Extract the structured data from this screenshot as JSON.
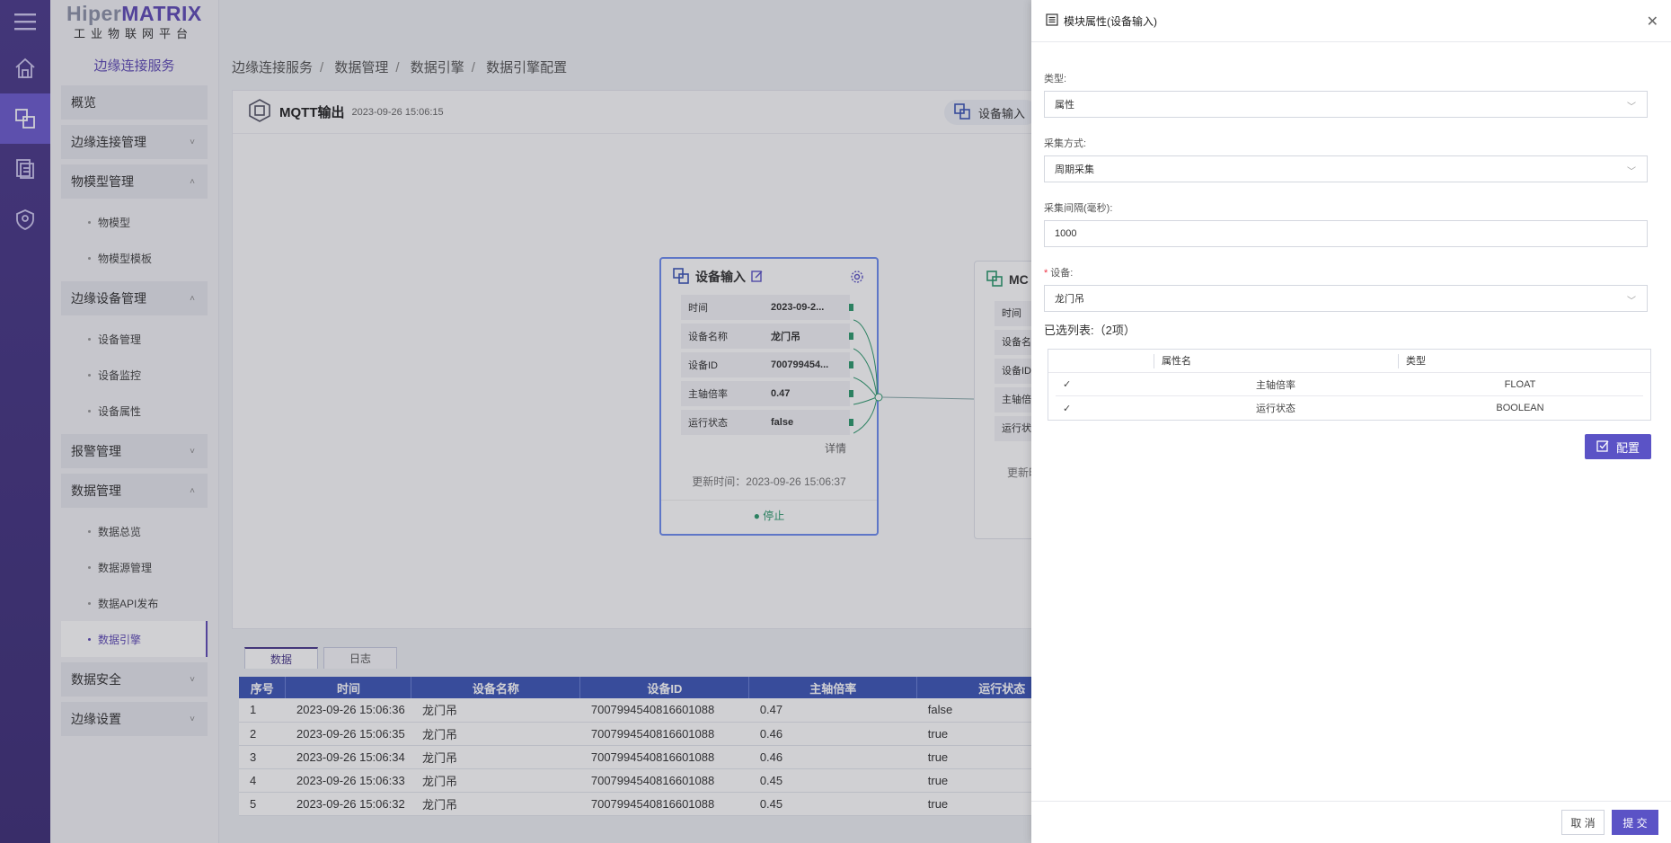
{
  "brand": {
    "name_prefix": "Hiper",
    "name_suffix": "MATRIX",
    "subtitle": "工业物联网平台"
  },
  "sidebar": {
    "service_title": "边缘连接服务",
    "items": [
      {
        "label": "概览",
        "type": "item"
      },
      {
        "label": "边缘连接管理",
        "type": "group",
        "chev": "˅"
      },
      {
        "label": "物模型管理",
        "type": "group",
        "chev": "˄"
      },
      {
        "label": "物模型",
        "type": "sub"
      },
      {
        "label": "物模型模板",
        "type": "sub"
      },
      {
        "label": "边缘设备管理",
        "type": "group",
        "chev": "˄"
      },
      {
        "label": "设备管理",
        "type": "sub"
      },
      {
        "label": "设备监控",
        "type": "sub"
      },
      {
        "label": "设备属性",
        "type": "sub"
      },
      {
        "label": "报警管理",
        "type": "group",
        "chev": "˅"
      },
      {
        "label": "数据管理",
        "type": "group",
        "chev": "˄"
      },
      {
        "label": "数据总览",
        "type": "sub"
      },
      {
        "label": "数据源管理",
        "type": "sub"
      },
      {
        "label": "数据API发布",
        "type": "sub"
      },
      {
        "label": "数据引擎",
        "type": "sub",
        "active": true
      },
      {
        "label": "数据安全",
        "type": "group",
        "chev": "˅"
      },
      {
        "label": "边缘设置",
        "type": "group",
        "chev": "˅"
      }
    ]
  },
  "breadcrumb": [
    "边缘连接服务",
    "数据管理",
    "数据引擎",
    "数据引擎配置"
  ],
  "canvas": {
    "title": "MQTT输出",
    "timestamp": "2023-09-26 15:06:15",
    "chip_label": "设备输入",
    "node": {
      "title": "设备输入",
      "rows": [
        {
          "k": "时间",
          "v": "2023-09-2..."
        },
        {
          "k": "设备名称",
          "v": "龙门吊"
        },
        {
          "k": "设备ID",
          "v": "700799454..."
        },
        {
          "k": "主轴倍率",
          "v": "0.47"
        },
        {
          "k": "运行状态",
          "v": "false"
        }
      ],
      "detail": "详情",
      "updated": "更新时间：2023-09-26 15:06:37",
      "status": "停止"
    },
    "node2": {
      "title": "MC",
      "rows": [
        "时间",
        "设备名",
        "设备ID",
        "主轴倍",
        "运行状"
      ],
      "updated": "更新时"
    }
  },
  "tabs": [
    "数据",
    "日志"
  ],
  "table": {
    "headers": [
      "序号",
      "时间",
      "设备名称",
      "设备ID",
      "主轴倍率",
      "运行状态"
    ],
    "rows": [
      [
        "1",
        "2023-09-26 15:06:36",
        "龙门吊",
        "7007994540816601088",
        "0.47",
        "false"
      ],
      [
        "2",
        "2023-09-26 15:06:35",
        "龙门吊",
        "7007994540816601088",
        "0.46",
        "true"
      ],
      [
        "3",
        "2023-09-26 15:06:34",
        "龙门吊",
        "7007994540816601088",
        "0.46",
        "true"
      ],
      [
        "4",
        "2023-09-26 15:06:33",
        "龙门吊",
        "7007994540816601088",
        "0.45",
        "true"
      ],
      [
        "5",
        "2023-09-26 15:06:32",
        "龙门吊",
        "7007994540816601088",
        "0.45",
        "true"
      ]
    ]
  },
  "drawer": {
    "title": "模块属性(设备输入)",
    "type_label": "类型:",
    "type_value": "属性",
    "method_label": "采集方式:",
    "method_value": "周期采集",
    "interval_label": "采集间隔(毫秒):",
    "interval_value": "1000",
    "device_label": "设备:",
    "device_value": "龙门吊",
    "selected_title": "已选列表:（2项）",
    "selected_headers": [
      "属性名",
      "类型"
    ],
    "selected_rows": [
      {
        "name": "主轴倍率",
        "type": "FLOAT"
      },
      {
        "name": "运行状态",
        "type": "BOOLEAN"
      }
    ],
    "config_label": "配置",
    "cancel_label": "取 消",
    "submit_label": "提 交"
  },
  "colors": {
    "accent": "#5b53c6",
    "rail": "#4b3a8c",
    "table_header": "#3d56b8",
    "status_green": "#2e9a6e"
  }
}
